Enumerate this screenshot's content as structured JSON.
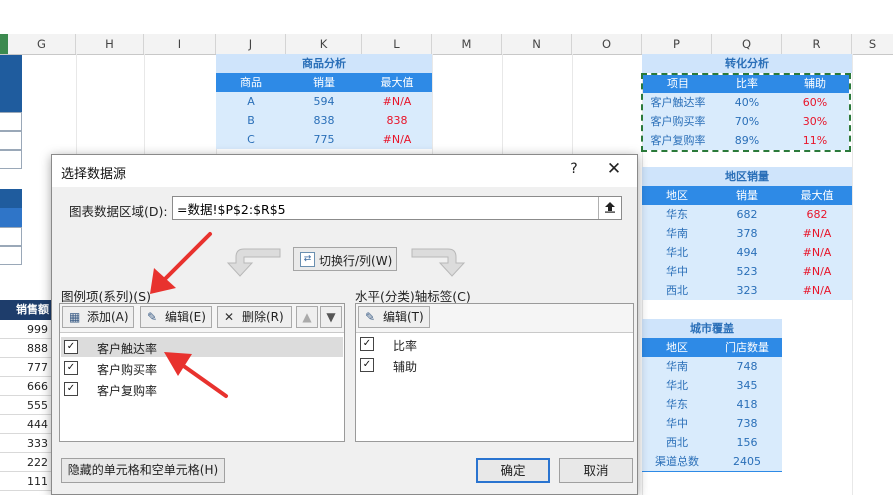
{
  "sheet": {
    "columns": [
      "G",
      "H",
      "I",
      "J",
      "K",
      "L",
      "M",
      "N",
      "O",
      "P",
      "Q",
      "R",
      "S"
    ],
    "sales_column": {
      "header": "销售额",
      "values": [
        "999",
        "888",
        "777",
        "666",
        "555",
        "444",
        "333",
        "222",
        "111"
      ]
    },
    "product_table": {
      "title": "商品分析",
      "headers": [
        "商品",
        "销量",
        "最大值"
      ],
      "rows": [
        [
          "A",
          "594",
          "#N/A"
        ],
        [
          "B",
          "838",
          "838"
        ],
        [
          "C",
          "775",
          "#N/A"
        ]
      ]
    },
    "conversion_table": {
      "title": "转化分析",
      "headers": [
        "项目",
        "比率",
        "辅助"
      ],
      "rows": [
        [
          "客户触达率",
          "40%",
          "60%"
        ],
        [
          "客户购买率",
          "70%",
          "30%"
        ],
        [
          "客户复购率",
          "89%",
          "11%"
        ]
      ]
    },
    "region_table": {
      "title": "地区销量",
      "headers": [
        "地区",
        "销量",
        "最大值"
      ],
      "rows": [
        [
          "华东",
          "682",
          "682"
        ],
        [
          "华南",
          "378",
          "#N/A"
        ],
        [
          "华北",
          "494",
          "#N/A"
        ],
        [
          "华中",
          "523",
          "#N/A"
        ],
        [
          "西北",
          "323",
          "#N/A"
        ]
      ]
    },
    "city_table": {
      "title": "城市覆盖",
      "headers": [
        "地区",
        "门店数量"
      ],
      "rows": [
        [
          "华南",
          "748"
        ],
        [
          "华北",
          "345"
        ],
        [
          "华东",
          "418"
        ],
        [
          "华中",
          "738"
        ],
        [
          "西北",
          "156"
        ],
        [
          "渠道总数",
          "2405"
        ]
      ]
    },
    "colors": {
      "accent": "#2e8ae6",
      "light": "#d9ebfc",
      "red": "#e8152a",
      "dark": "#1e3d6b",
      "dash": "#2b7a3a"
    }
  },
  "dialog": {
    "title": "选择数据源",
    "help": "?",
    "close": "✕",
    "range_label": "图表数据区域(D):",
    "range_value": "=数据!$P$2:$R$5",
    "switch_label": "切换行/列(W)",
    "legend_label": "图例项(系列)(S)",
    "axis_label": "水平(分类)轴标签(C)",
    "series_toolbar": {
      "add": "添加(A)",
      "edit": "编辑(E)",
      "delete": "删除(R)"
    },
    "series": [
      {
        "label": "客户触达率",
        "checked": true,
        "selected": true
      },
      {
        "label": "客户购买率",
        "checked": true,
        "selected": false
      },
      {
        "label": "客户复购率",
        "checked": true,
        "selected": false
      }
    ],
    "axis_toolbar": {
      "edit": "编辑(T)"
    },
    "axis_items": [
      {
        "label": "比率",
        "checked": true
      },
      {
        "label": "辅助",
        "checked": true
      }
    ],
    "hidden_cells_label": "隐藏的单元格和空单元格(H)",
    "ok_label": "确定",
    "cancel_label": "取消"
  }
}
